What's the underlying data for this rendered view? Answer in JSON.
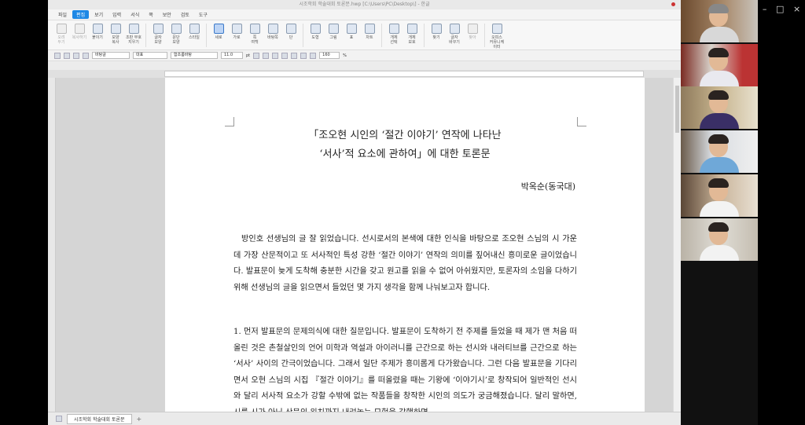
{
  "window": {
    "title": "시조학회 학술대회 토론문.hwp [C:\\Users\\PC\\Desktop\\] - 한글"
  },
  "menu": {
    "items": [
      "파일",
      "편집",
      "보기",
      "입력",
      "서식",
      "쪽",
      "보안",
      "검토",
      "도구"
    ],
    "active": "편집"
  },
  "ribbon": {
    "buttons": [
      {
        "label": "오려\n두기"
      },
      {
        "label": "복사하기"
      },
      {
        "label": "붙이기"
      },
      {
        "label": "모양\n복사"
      },
      {
        "label": "조판 부호\n지우기"
      },
      {
        "label": "글자\n모양"
      },
      {
        "label": "문단\n모양"
      },
      {
        "label": "스타일"
      },
      {
        "label": "세로"
      },
      {
        "label": "가로"
      },
      {
        "label": "쪽\n여백"
      },
      {
        "label": "바탕쪽"
      },
      {
        "label": "단"
      },
      {
        "label": "도형"
      },
      {
        "label": "그림"
      },
      {
        "label": "표"
      },
      {
        "label": "차트"
      },
      {
        "label": "개체\n선택"
      },
      {
        "label": "개체\n보호"
      },
      {
        "label": "찾기"
      },
      {
        "label": "글자\n바꾸기"
      },
      {
        "label": "찾아"
      },
      {
        "label": "오피스\n커뮤니케이터"
      }
    ]
  },
  "formatbar": {
    "style": "바탕글",
    "script": "대표",
    "font": "함초롬바탕",
    "size": "11.0",
    "size_unit": "pt",
    "zoom": "160",
    "zoom_unit": "%"
  },
  "document": {
    "title_line1": "「조오현 시인의 ‘절간 이야기’ 연작에 나타난",
    "title_line2": "‘서사’적 요소에 관하여」에 대한 토론문",
    "author": "박옥순(동국대)",
    "para1": "방인호 선생님의 글 잘 읽었습니다. 선시로서의 본색에 대한 인식을 바탕으로 조오현 스님의 시 가운데 가장 산문적이고 또 서사적인 특성 강한 ‘절간 이야기’ 연작의 의미를 짚어내신 흥미로운 글이었습니다. 발표문이 늦게 도착해 충분한 시간을 갖고 원고를 읽을 수 없어 아쉬웠지만, 토론자의 소임을 다하기 위해 선생님의 글을 읽으면서 들었던 몇 가지 생각을 함께 나눠보고자 합니다.",
    "para2": "1. 먼저 발표문의 문제의식에 대한 질문입니다. 발표문이 도착하기 전 주제를 들었을 때 제가 맨 처음 떠올린 것은 촌철살인의 언어 미학과 역설과 아이러니를 근간으로 하는 선시와 내러티브를 근간으로 하는 ‘서사’ 사이의 간극이었습니다. 그래서 일단 주제가 흥미롭게 다가왔습니다. 그런 다음 발표문을 기다리면서 오현 스님의 시집 『절간 이야기』를 떠올렸을 때는 기왕에 ‘이야기시’로 창작되어 일반적인 선시와 달리 서사적 요소가 강할 수밖에 없는 작품들을 창작한 시인의 의도가 궁금해졌습니다. 달리 말하면, 시를 시가 아닌 산문의 위치까지 내려놓는 모험을 감행하면"
  },
  "statusbar": {
    "tab": "시조학회 학술대회 토론문",
    "add": "+"
  }
}
